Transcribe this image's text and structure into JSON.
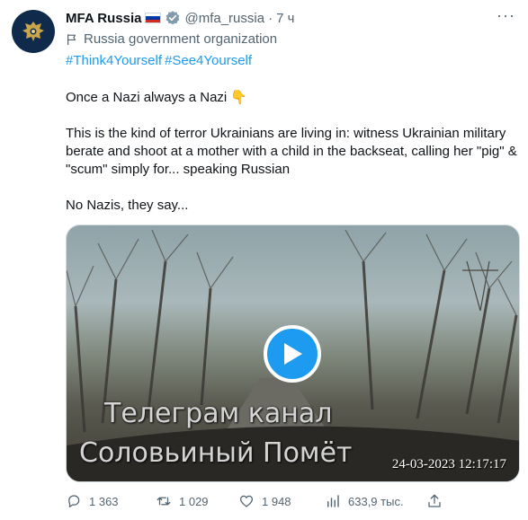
{
  "tweet": {
    "author": {
      "name": "MFA Russia",
      "handle": "@mfa_russia",
      "separator": "·",
      "time": "7 ч",
      "org_label": "Russia government organization",
      "flag_colors": [
        "#ffffff",
        "#0039a6",
        "#d52b1e"
      ],
      "verified_color": "#829aab"
    },
    "hashtags": [
      "#Think4Yourself",
      "#See4Yourself"
    ],
    "paragraphs": [
      "Once a Nazi always a Nazi 👇",
      "This is the kind of terror Ukrainians are living in: witness Ukrainian military berate and shoot at a mother with a child in the backseat, calling her \"pig\" & \"scum\" simply for... speaking Russian",
      "No Nazis, they say..."
    ],
    "media": {
      "watermark_line1": "Телеграм канал",
      "watermark_line2": "Соловьиный Помёт",
      "timestamp": "24-03-2023 12:17:17",
      "play_icon": "play-icon"
    },
    "stats": {
      "replies": "1 363",
      "retweets": "1 029",
      "likes": "1 948",
      "views": "633,9 тыс."
    }
  },
  "colors": {
    "link": "#1d9bf0",
    "secondary_text": "#536471",
    "primary_text": "#0f1419"
  }
}
